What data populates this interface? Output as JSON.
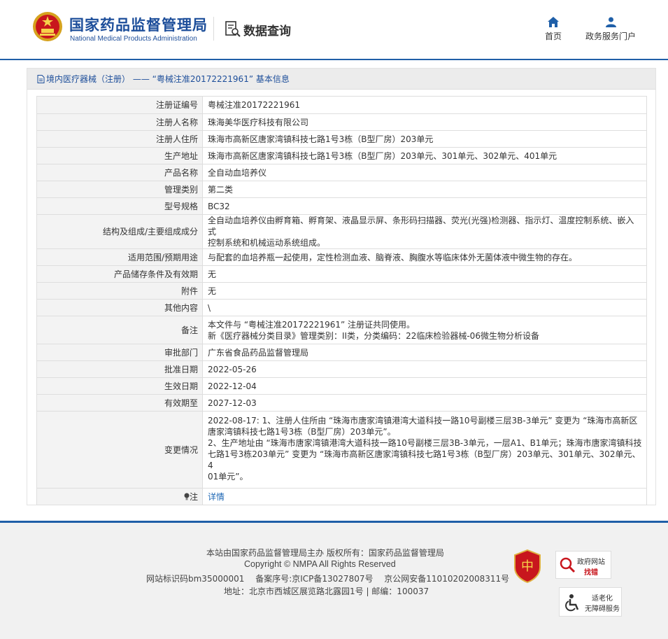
{
  "header": {
    "logo_cn": "国家药品监督管理局",
    "logo_en": "National Medical Products Administration",
    "query_title": "数据查询",
    "nav": [
      {
        "label": "首页",
        "icon": "home-icon"
      },
      {
        "label": "政务服务门户",
        "icon": "user-icon"
      }
    ]
  },
  "panel": {
    "breadcrumb": "境内医疗器械（注册） —— “粤械注准20172221961” 基本信息"
  },
  "record": {
    "reg_no": {
      "label": "注册证编号",
      "value": "粤械注准20172221961"
    },
    "registrant": {
      "label": "注册人名称",
      "value": "珠海美华医疗科技有限公司"
    },
    "registrant_addr": {
      "label": "注册人住所",
      "value": "珠海市高新区唐家湾镇科技七路1号3栋（B型厂房）203单元"
    },
    "production_addr": {
      "label": "生产地址",
      "value": "珠海市高新区唐家湾镇科技七路1号3栋（B型厂房）203单元、301单元、302单元、401单元"
    },
    "product_name": {
      "label": "产品名称",
      "value": "全自动血培养仪"
    },
    "category": {
      "label": "管理类别",
      "value": "第二类"
    },
    "model": {
      "label": "型号规格",
      "value": "BC32"
    },
    "structure": {
      "label": "结构及组成/主要组成成分",
      "value_lines": [
        "全自动血培养仪由孵育箱、孵育架、液晶显示屏、条形码扫描器、荧光(光强)检测器、指示灯、温度控制系统、嵌入式",
        "控制系统和机械运动系统组成。"
      ]
    },
    "scope": {
      "label": "适用范围/预期用途",
      "value": "与配套的血培养瓶一起使用，定性检测血液、脑脊液、胸腹水等临床体外无菌体液中微生物的存在。"
    },
    "storage": {
      "label": "产品储存条件及有效期",
      "value": "无"
    },
    "attachment": {
      "label": "附件",
      "value": "无"
    },
    "other": {
      "label": "其他内容",
      "value": "\\"
    },
    "remark": {
      "label": "备注",
      "value_lines": [
        "本文件与 “粤械注准20172221961” 注册证共同使用。",
        "新《医疗器械分类目录》管理类别：II类，分类编码：22临床检验器械-06微生物分析设备"
      ]
    },
    "approval_dept": {
      "label": "审批部门",
      "value": "广东省食品药品监督管理局"
    },
    "approval_date": {
      "label": "批准日期",
      "value": "2022-05-26"
    },
    "effective_date": {
      "label": "生效日期",
      "value": "2022-12-04"
    },
    "expiry_date": {
      "label": "有效期至",
      "value": "2027-12-03"
    },
    "changes": {
      "label": "变更情况",
      "value_lines": [
        "2022-08-17: 1、注册人住所由 “珠海市唐家湾镇港湾大道科技一路10号副楼三层3B-3单元” 变更为 “珠海市高新区",
        "唐家湾镇科技七路1号3栋（B型厂房）203单元”。",
        "2、生产地址由 “珠海市唐家湾镇港湾大道科技一路10号副楼三层3B-3单元，一层A1、B1单元；珠海市唐家湾镇科技",
        "七路1号3栋203单元” 变更为 “珠海市高新区唐家湾镇科技七路1号3栋（B型厂房）203单元、301单元、302单元、4",
        "01单元”。"
      ]
    },
    "note": {
      "label": "注",
      "value": "详情"
    }
  },
  "footer": {
    "line1": "本站由国家药品监督管理局主办 版权所有：国家药品监督管理局",
    "line2": "Copyright © NMPA All Rights Reserved",
    "line3": "网站标识码bm35000001　 备案序号:京ICP备13027807号　 京公网安备11010202008311号",
    "line4": "地址：北京市西城区展览路北露园1号 | 邮编：100037",
    "badge2_top": "政府网站",
    "badge2_bottom": "找错",
    "badge3_top": "适老化",
    "badge3_bottom": "无障碍服务"
  },
  "colors": {
    "brand": "#1d4e9a",
    "link": "#1e67b5",
    "label_bg": "#f3f3f3",
    "footer_bg": "#f1f1f1"
  }
}
